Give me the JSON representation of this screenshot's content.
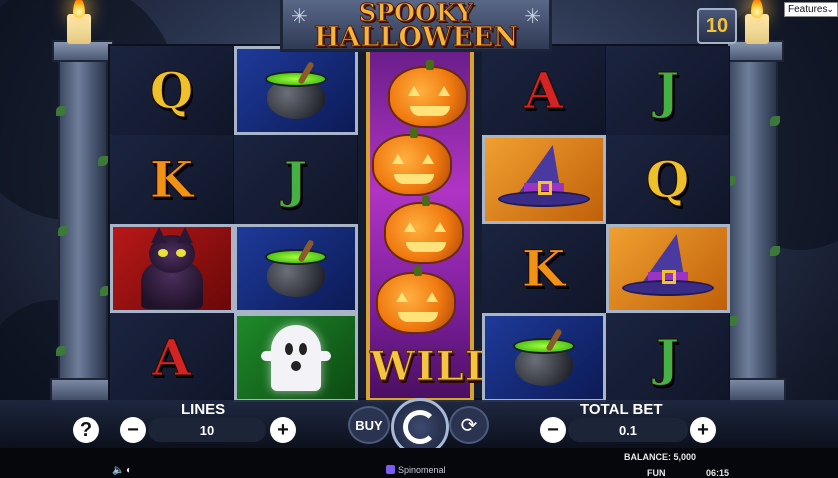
{
  "game": {
    "title_line1": "SPOOKY",
    "title_line2": "HALLOWEEN",
    "multiplier": "10",
    "features_select": "Features"
  },
  "reels": [
    [
      "Q",
      "K",
      "cat",
      "A"
    ],
    [
      "cauldron",
      "J",
      "cauldron",
      "ghost"
    ],
    [
      "wild"
    ],
    [
      "A",
      "witch-hat",
      "K",
      "cauldron"
    ],
    [
      "J",
      "Q",
      "witch-hat",
      "J"
    ]
  ],
  "wild": {
    "label": "WILD"
  },
  "controls": {
    "help": "?",
    "lines_label": "LINES",
    "lines_value": "10",
    "minus": "−",
    "plus": "+",
    "buy_label": "BUY",
    "total_bet_label": "TOTAL BET",
    "total_bet_value": "0.1"
  },
  "status": {
    "balance": "BALANCE: 5,000",
    "mode": "FUN",
    "time": "06:15",
    "provider": "Spinomenal"
  }
}
